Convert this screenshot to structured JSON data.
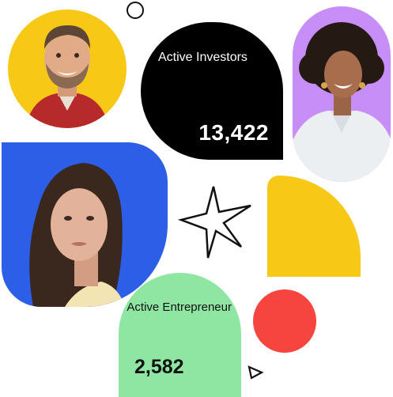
{
  "investors": {
    "label": "Active Investors",
    "value": "13,422"
  },
  "entrepreneurs": {
    "label": "Active Entrepreneur",
    "value": "2,582"
  },
  "colors": {
    "yellow": "#f7c815",
    "black": "#000000",
    "purple": "#c88ef8",
    "blue": "#2c5ee8",
    "green": "#8fe6a3",
    "red": "#f6443f"
  },
  "photos": [
    {
      "name": "smiling-man-portrait"
    },
    {
      "name": "smiling-woman-curly-hair-portrait"
    },
    {
      "name": "young-woman-portrait"
    }
  ],
  "decorations": [
    "outline-circle",
    "sparkle-star",
    "outline-triangle"
  ]
}
